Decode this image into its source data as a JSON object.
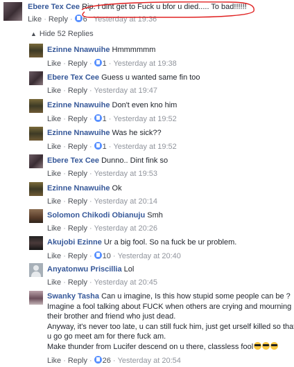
{
  "top_comment": {
    "author": "Ebere Tex Cee",
    "text": "Rip. I dint get to Fuck u bfor u died..... To bad!!!!!!",
    "like": "Like",
    "reply": "Reply",
    "reactions": "6",
    "time": "Yesterday at 19:36"
  },
  "hide_replies": "Hide 52 Replies",
  "replies": [
    {
      "author": "Ezinne Nnawuihe",
      "text": "Hmmmmmm",
      "like": "Like",
      "reply": "Reply",
      "reactions": "1",
      "time": "Yesterday at 19:38"
    },
    {
      "author": "Ebere Tex Cee",
      "text": "Guess u wanted same fin too",
      "like": "Like",
      "reply": "Reply",
      "reactions": "",
      "time": "Yesterday at 19:47"
    },
    {
      "author": "Ezinne Nnawuihe",
      "text": "Don't even kno him",
      "like": "Like",
      "reply": "Reply",
      "reactions": "1",
      "time": "Yesterday at 19:52"
    },
    {
      "author": "Ezinne Nnawuihe",
      "text": "Was he sick??",
      "like": "Like",
      "reply": "Reply",
      "reactions": "1",
      "time": "Yesterday at 19:52"
    },
    {
      "author": "Ebere Tex Cee",
      "text": "Dunno.. Dint fink so",
      "like": "Like",
      "reply": "Reply",
      "reactions": "",
      "time": "Yesterday at 19:53"
    },
    {
      "author": "Ezinne Nnawuihe",
      "text": "Ok",
      "like": "Like",
      "reply": "Reply",
      "reactions": "",
      "time": "Yesterday at 20:14"
    },
    {
      "author": "Solomon Chikodi Obianuju",
      "text": "Smh",
      "like": "Like",
      "reply": "Reply",
      "reactions": "",
      "time": "Yesterday at 20:26"
    },
    {
      "author": "Akujobi Ezinne",
      "text": "Ur a big fool. So na fuck be ur problem.",
      "like": "Like",
      "reply": "Reply",
      "reactions": "10",
      "time": "Yesterday at 20:40"
    },
    {
      "author": "Anyatonwu Priscillia",
      "text": "Lol",
      "like": "Like",
      "reply": "Reply",
      "reactions": "",
      "time": "Yesterday at 20:45"
    }
  ],
  "swanky": {
    "author": "Swanky Tasha",
    "lines": [
      "Can u imagine, Is this how stupid some people can be ?",
      "Imagine a fool talking about FUCK when others are crying and mourning",
      "their brother and friend who just dead.",
      "Anyway, it's never too late, u can still fuck him, just get urself killed so that",
      "u go go meet am for there fuck am.",
      "Make thunder from Lucifer descend on u there, classless fool"
    ],
    "like": "Like",
    "reply": "Reply",
    "reactions": "26",
    "time": "Yesterday at 20:54"
  },
  "colors": {
    "name": "#365899",
    "meta": "#90949c",
    "reaction": "#5890ff",
    "annotation": "#e02020"
  },
  "icons": {
    "hide": "chevron-up-icon",
    "reaction": "like-reaction-icon",
    "emoji": "sunglasses-emoji-icon"
  }
}
